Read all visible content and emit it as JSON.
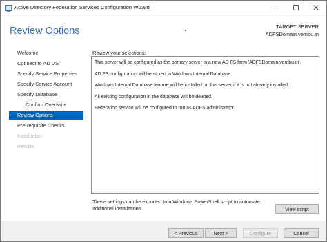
{
  "window": {
    "title": "Active Directory Federation Services Configuration Wizard"
  },
  "header": {
    "title": "Review Options",
    "target_label": "TARGET SERVER",
    "target_value": "ADFSDomain.vembu.in"
  },
  "nav": {
    "items": [
      {
        "label": "Welcome",
        "state": "normal"
      },
      {
        "label": "Connect to AD DS",
        "state": "normal"
      },
      {
        "label": "Specify Service Properties",
        "state": "normal"
      },
      {
        "label": "Specify Service Account",
        "state": "normal"
      },
      {
        "label": "Specify Database",
        "state": "normal"
      },
      {
        "label": "Confirm Overwrite",
        "state": "sub"
      },
      {
        "label": "Review Options",
        "state": "active"
      },
      {
        "label": "Pre-requisite Checks",
        "state": "normal"
      },
      {
        "label": "Installation",
        "state": "disabled"
      },
      {
        "label": "Results",
        "state": "disabled"
      }
    ]
  },
  "main": {
    "review_label": "Review your selections:",
    "review_lines": [
      "This server will be configured as the primary server in a new AD FS farm 'ADFSDomain.vembu.in'.",
      "AD FS configuration will be stored in Windows Internal Database.",
      "Windows Internal Database feature will be installed on this server if it is not already installed.",
      "All existing configuration in the database will be deleted.",
      "Federation service will be configured to run as ADFS\\administrator."
    ],
    "export_text": "These settings can be exported to a Windows PowerShell script to automate additional installations",
    "view_script_label": "View script"
  },
  "footer": {
    "previous_label": "< Previous",
    "next_label": "Next >",
    "configure_label": "Configure",
    "cancel_label": "Cancel"
  },
  "colors": {
    "accent": "#0063b1",
    "header_title": "#3a72b0",
    "disabled_text": "#b8b8b8"
  },
  "icons": {
    "app": "adfs-wizard-icon",
    "minimize": "minimize-icon",
    "maximize": "maximize-icon",
    "close": "close-icon"
  }
}
